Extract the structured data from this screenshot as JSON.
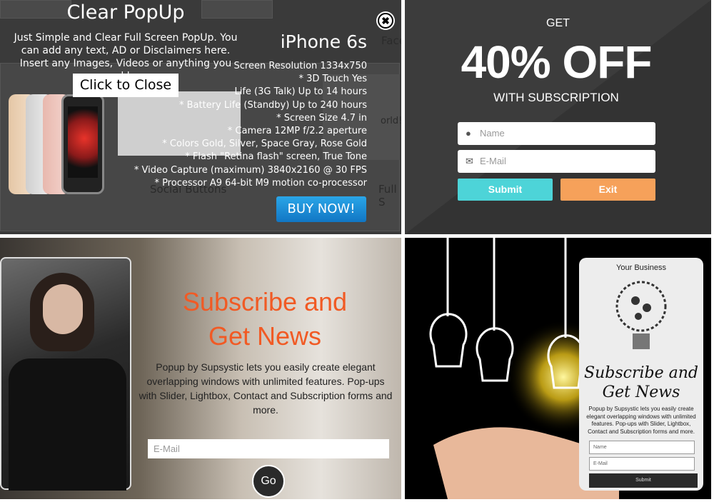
{
  "clear_popup": {
    "title": "Clear PopUp",
    "description": "Just Simple and Clear Full Screen PopUp. You can add any text, AD or Disclaimers here. Insert any Images, Videos or anything you need here.",
    "close_label": "Click to Close",
    "close_icon": "✖",
    "product_title": "iPhone 6s",
    "specs": [
      "Screen Resolution 1334x750",
      "* 3D Touch Yes",
      "Life (3G Talk) Up to 14 hours",
      "* Battery Life (Standby) Up to 240 hours",
      "* Screen Size 4.7 in",
      "* Camera 12MP f/2.2 aperture",
      "* Colors Gold, Silver, Space Gray, Rose Gold",
      "* Flash \"Retina flash\" screen, True Tone",
      "* Video Capture (maximum) 3840x2160 @ 30 FPS",
      "* Processor A9 64-bit M9 motion co-processor"
    ],
    "buy_label": "BUY NOW!",
    "bg_text": {
      "social": "Social Buttons",
      "full": "Full S",
      "face": "Face",
      "world": "orld!"
    }
  },
  "discount_popup": {
    "get": "GET",
    "headline": "40% OFF",
    "subline": "WITH SUBSCRIPTION",
    "name_placeholder": "Name",
    "email_placeholder": "E-Mail",
    "submit_label": "Submit",
    "exit_label": "Exit",
    "colors": {
      "submit": "#4dd4d8",
      "exit": "#f6a15a"
    }
  },
  "subscribe_popup": {
    "title_line1": "Subscribe and",
    "title_line2": "Get News",
    "description": "Popup by Supsystic lets you easily create elegant overlapping windows with unlimited features. Pop-ups with Slider, Lightbox, Contact and Subscription forms and more.",
    "email_placeholder": "E-Mail",
    "go_label": "Go",
    "accent": "#f15a24"
  },
  "bulb_popup": {
    "business": "Your Business",
    "title_line1": "Subscribe and",
    "title_line2": "Get News",
    "description": "Popup by Supsystic lets you easily create elegant overlapping windows with unlimited features. Pop-ups with Slider, Lightbox, Contact and Subscription forms and more.",
    "name_placeholder": "Name",
    "email_placeholder": "E-Mail",
    "submit_label": "Submit"
  }
}
